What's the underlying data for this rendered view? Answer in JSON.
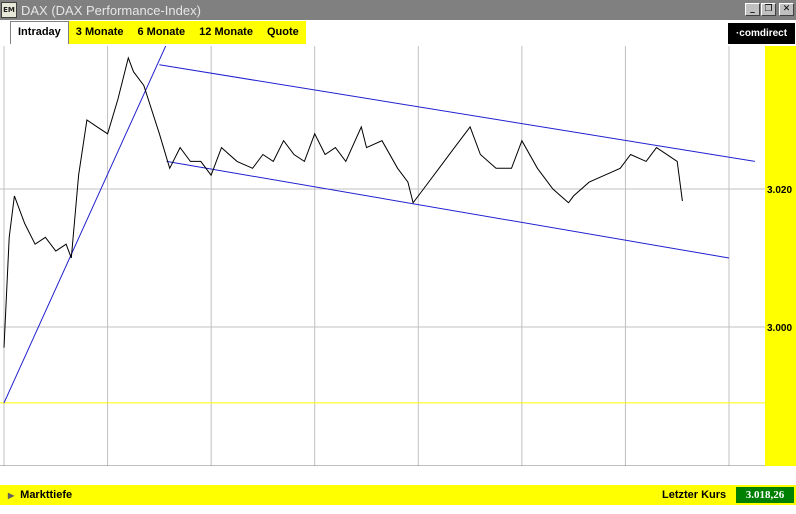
{
  "window": {
    "title": "DAX (DAX Performance-Index)",
    "app_icon_text": "EM"
  },
  "tabs": [
    {
      "label": "Intraday",
      "active": true
    },
    {
      "label": "3 Monate",
      "active": false
    },
    {
      "label": "6 Monate",
      "active": false
    },
    {
      "label": "12 Monate",
      "active": false
    },
    {
      "label": "Quote",
      "active": false
    }
  ],
  "logo": {
    "text": "·comdirect"
  },
  "chart_data": {
    "type": "line",
    "title": "",
    "xlabel": "",
    "ylabel": "",
    "x_ticks": [
      "9",
      "10",
      "11",
      "12",
      "13",
      "14",
      "15",
      "16"
    ],
    "y_ticks": [
      "3.020",
      "3.000"
    ],
    "grid": true,
    "xlim": [
      9,
      16
    ],
    "ylim": [
      2986,
      3040
    ],
    "reference_line_y": 2989,
    "series": [
      {
        "name": "",
        "x": [
          9.0,
          9.05,
          9.1,
          9.2,
          9.3,
          9.4,
          9.5,
          9.6,
          9.65,
          9.72,
          9.8,
          9.9,
          10.0,
          10.1,
          10.2,
          10.25,
          10.35,
          10.5,
          10.6,
          10.7,
          10.8,
          10.9,
          11.0,
          11.1,
          11.25,
          11.4,
          11.5,
          11.6,
          11.7,
          11.8,
          11.9,
          12.0,
          12.1,
          12.2,
          12.3,
          12.45,
          12.5,
          12.65,
          12.8,
          12.9,
          12.95,
          13.05,
          13.2,
          13.35,
          13.5,
          13.6,
          13.75,
          13.9,
          14.0,
          14.15,
          14.3,
          14.45,
          14.5,
          14.65,
          14.8,
          14.95,
          15.05,
          15.2,
          15.3,
          15.5,
          15.55
        ],
        "values": [
          2997,
          3013,
          3019,
          3015,
          3012,
          3013,
          3011,
          3012,
          3010,
          3022,
          3030,
          3029,
          3028,
          3033,
          3039,
          3037,
          3035,
          3028,
          3023,
          3026,
          3024,
          3024,
          3022,
          3026,
          3024,
          3023,
          3025,
          3024,
          3027,
          3025,
          3024,
          3028,
          3025,
          3026,
          3024,
          3029,
          3026,
          3027,
          3023,
          3021,
          3018,
          3020,
          3023,
          3026,
          3029,
          3025,
          3023,
          3023,
          3027,
          3023,
          3020,
          3018,
          3019,
          3021,
          3022,
          3023,
          3025,
          3024,
          3026,
          3024,
          3018.26
        ]
      }
    ],
    "trendlines": [
      {
        "name": "",
        "x": [
          9.0,
          10.63
        ],
        "values": [
          2989,
          3043
        ]
      },
      {
        "name": "",
        "x": [
          10.5,
          16.25
        ],
        "values": [
          3038,
          3024
        ]
      },
      {
        "name": "",
        "x": [
          10.57,
          16.0
        ],
        "values": [
          3024,
          3010
        ]
      }
    ]
  },
  "footer": {
    "market_depth": "Markttiefe",
    "last_price_label": "Letzter Kurs",
    "last_price_value": "3.018,26"
  },
  "colors": {
    "chart_line": "#000000",
    "trendline": "#2020d0",
    "grid": "#c0c0c0",
    "yellow": "#ffff00",
    "last_value_bg": "#008000"
  }
}
